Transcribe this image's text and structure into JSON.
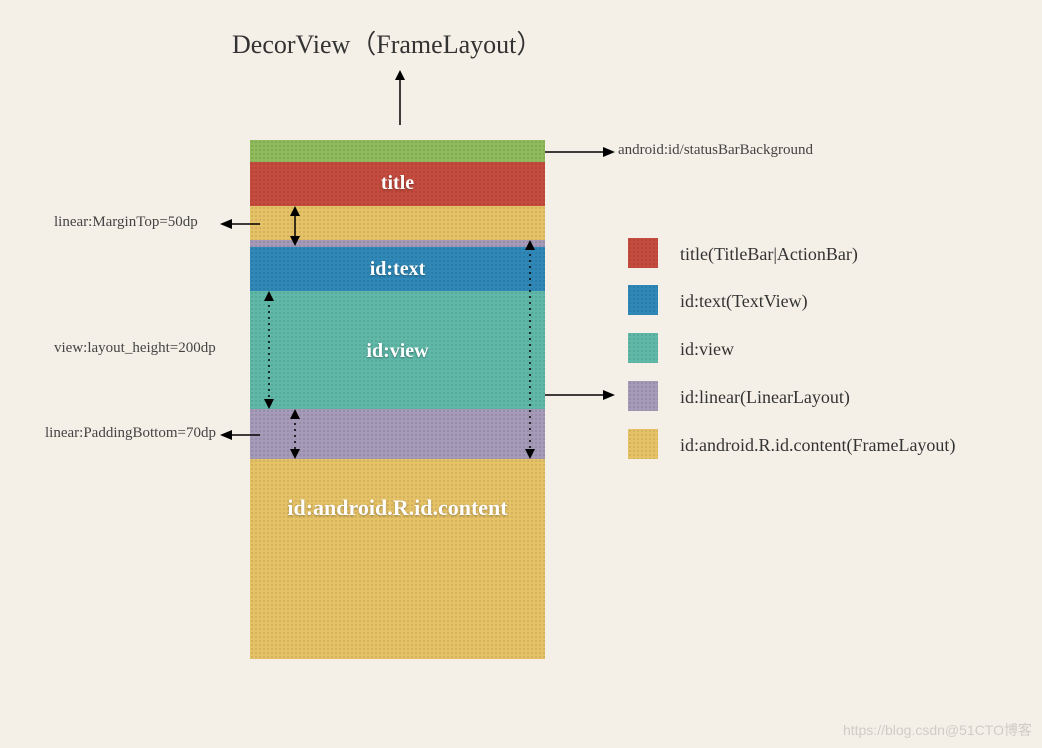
{
  "diagram": {
    "title": "DecorView（FrameLayout）",
    "layers": {
      "title_bar": "title",
      "id_text": "id:text",
      "id_view": "id:view",
      "id_content": "id:android.R.id.content"
    },
    "callouts": {
      "status_bar": "android:id/statusBarBackground",
      "margin_top": "linear:MarginTop=50dp",
      "layout_height": "view:layout_height=200dp",
      "padding_bottom": "linear:PaddingBottom=70dp"
    },
    "legend": [
      {
        "color": "#c44b3d",
        "label": "title(TitleBar|ActionBar)"
      },
      {
        "color": "#2f88b7",
        "label": "id:text(TextView)"
      },
      {
        "color": "#5fb8a8",
        "label": "id:view"
      },
      {
        "color": "#a59ab8",
        "label": "id:linear(LinearLayout)"
      },
      {
        "color": "#e6c267",
        "label": "id:android.R.id.content(FrameLayout)"
      }
    ],
    "watermark": "https://blog.csdn@51CTO博客"
  }
}
